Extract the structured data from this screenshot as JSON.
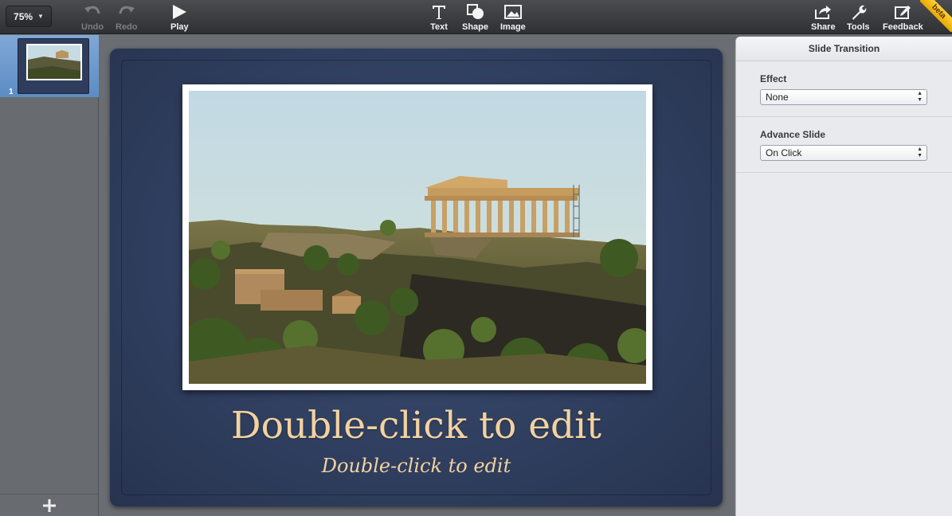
{
  "toolbar": {
    "zoom_value": "75%",
    "undo_label": "Undo",
    "redo_label": "Redo",
    "play_label": "Play",
    "text_label": "Text",
    "shape_label": "Shape",
    "image_label": "Image",
    "share_label": "Share",
    "tools_label": "Tools",
    "feedback_label": "Feedback",
    "beta_label": "beta"
  },
  "navigator": {
    "slides": [
      {
        "number": "1"
      }
    ]
  },
  "slide": {
    "title": "Double-click to edit",
    "subtitle": "Double-click to edit",
    "colors": {
      "background": "#2f3e5e",
      "text": "#f3d2a0"
    }
  },
  "inspector": {
    "title": "Slide Transition",
    "effect_label": "Effect",
    "effect_value": "None",
    "advance_label": "Advance Slide",
    "advance_value": "On Click"
  }
}
